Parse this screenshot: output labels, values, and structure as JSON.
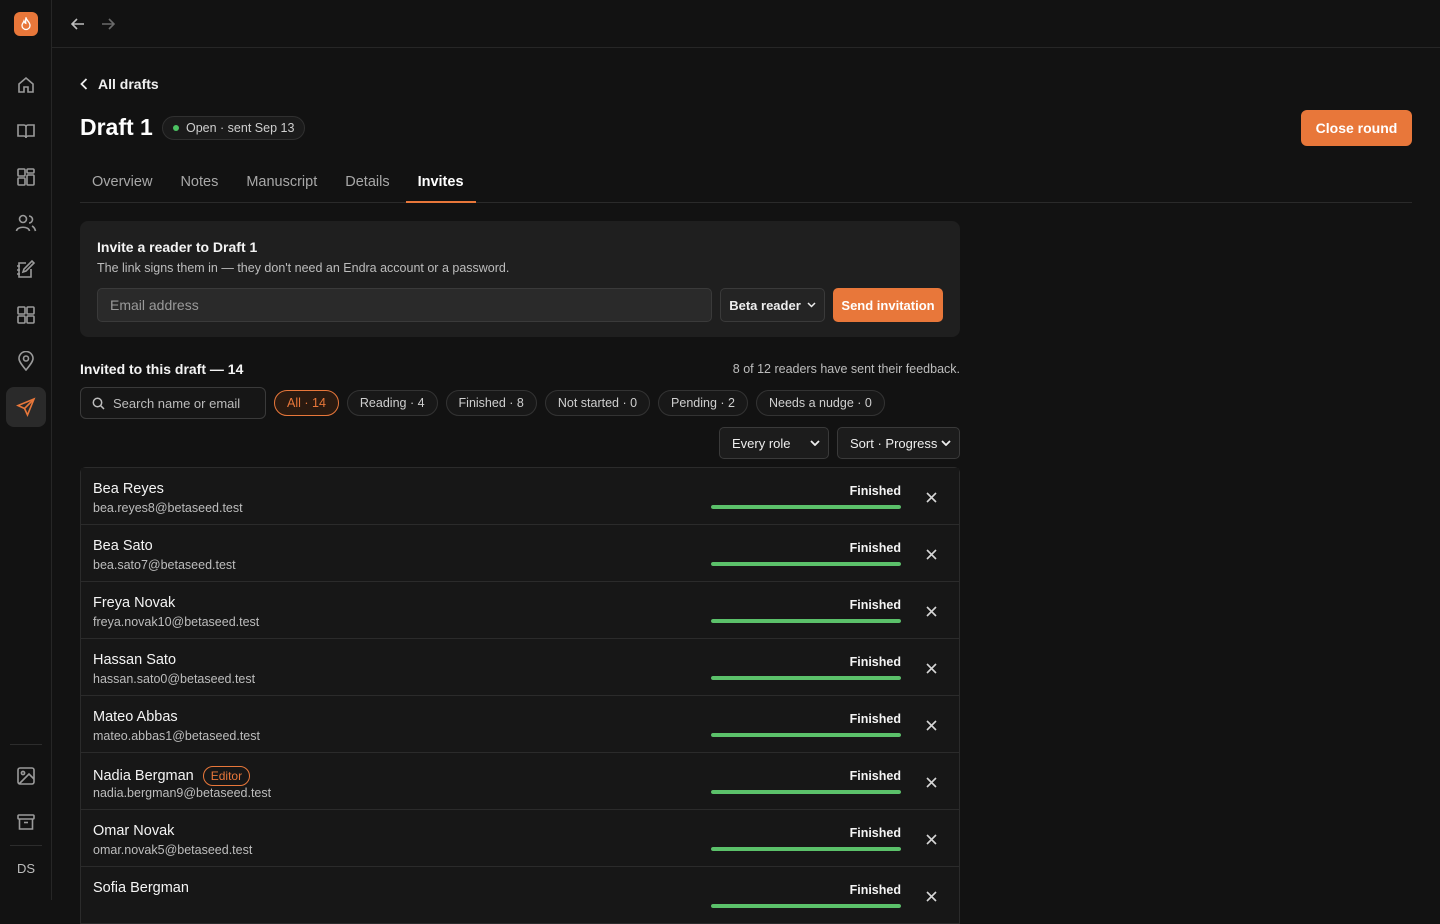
{
  "app": {
    "logo_icon": "flame-icon",
    "avatar_initials": "DS",
    "accent": "#e8773a"
  },
  "sidebar": {
    "items": [
      {
        "name": "home-icon"
      },
      {
        "name": "book-icon"
      },
      {
        "name": "grid-icon"
      },
      {
        "name": "users-icon"
      },
      {
        "name": "edit-notebook-icon"
      },
      {
        "name": "apps-icon"
      },
      {
        "name": "map-pin-icon"
      },
      {
        "name": "send-icon",
        "active": true
      }
    ],
    "bottom": [
      {
        "name": "image-icon"
      },
      {
        "name": "archive-icon"
      }
    ]
  },
  "back_link": "All drafts",
  "draft": {
    "title": "Draft 1",
    "status": "Open · sent Sep 13",
    "close_label": "Close round"
  },
  "tabs": [
    "Overview",
    "Notes",
    "Manuscript",
    "Details",
    "Invites"
  ],
  "active_tab": "Invites",
  "invite": {
    "heading": "Invite a reader to Draft 1",
    "sub": "The link signs them in — they don't need an Endra account or a password.",
    "email_placeholder": "Email address",
    "role": "Beta reader",
    "send_label": "Send invitation"
  },
  "list": {
    "heading": "Invited to this draft — 14",
    "summary": "8 of 12 readers have sent their feedback.",
    "search_placeholder": "Search name or email",
    "chips": [
      {
        "label": "All · 14",
        "active": true
      },
      {
        "label": "Reading · 4"
      },
      {
        "label": "Finished · 8"
      },
      {
        "label": "Not started · 0"
      },
      {
        "label": "Pending · 2"
      },
      {
        "label": "Needs a nudge · 0"
      }
    ],
    "role_filter": "Every role",
    "sort": "Sort · Progress"
  },
  "readers": [
    {
      "name": "Bea Reyes",
      "email": "bea.reyes8@betaseed.test",
      "status": "Finished",
      "progress": 1.0
    },
    {
      "name": "Bea Sato",
      "email": "bea.sato7@betaseed.test",
      "status": "Finished",
      "progress": 1.0
    },
    {
      "name": "Freya Novak",
      "email": "freya.novak10@betaseed.test",
      "status": "Finished",
      "progress": 1.0
    },
    {
      "name": "Hassan Sato",
      "email": "hassan.sato0@betaseed.test",
      "status": "Finished",
      "progress": 1.0
    },
    {
      "name": "Mateo Abbas",
      "email": "mateo.abbas1@betaseed.test",
      "status": "Finished",
      "progress": 1.0
    },
    {
      "name": "Nadia Bergman",
      "email": "nadia.bergman9@betaseed.test",
      "status": "Finished",
      "progress": 1.0,
      "badge": "Editor"
    },
    {
      "name": "Omar Novak",
      "email": "omar.novak5@betaseed.test",
      "status": "Finished",
      "progress": 1.0
    },
    {
      "name": "Sofia Bergman",
      "email": "",
      "status": "Finished",
      "progress": 1.0
    }
  ]
}
